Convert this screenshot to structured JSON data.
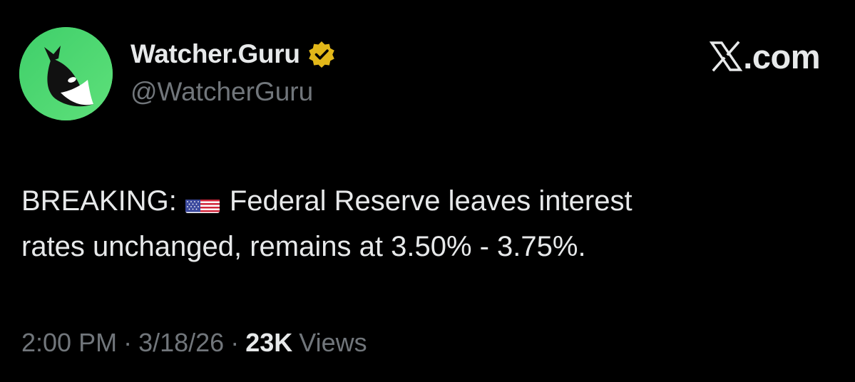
{
  "author": {
    "display_name": "Watcher.Guru",
    "handle": "@WatcherGuru",
    "verified": true,
    "verified_badge_color": "#e2b719",
    "avatar_icon": "whale-icon",
    "avatar_bg": "#4cd964"
  },
  "brand": {
    "logo_icon": "x-logo-icon",
    "text": ".com"
  },
  "tweet": {
    "prefix": "BREAKING:",
    "flag_icon": "us-flag-icon",
    "line1_rest": "Federal Reserve leaves interest",
    "line2": "rates unchanged, remains at 3.50% - 3.75%."
  },
  "meta": {
    "time": "2:00 PM",
    "separator": "·",
    "date": "3/18/26",
    "views_count": "23K",
    "views_label": "Views"
  },
  "colors": {
    "background": "#000000",
    "primary_text": "#e7e9ea",
    "secondary_text": "#71767b"
  }
}
